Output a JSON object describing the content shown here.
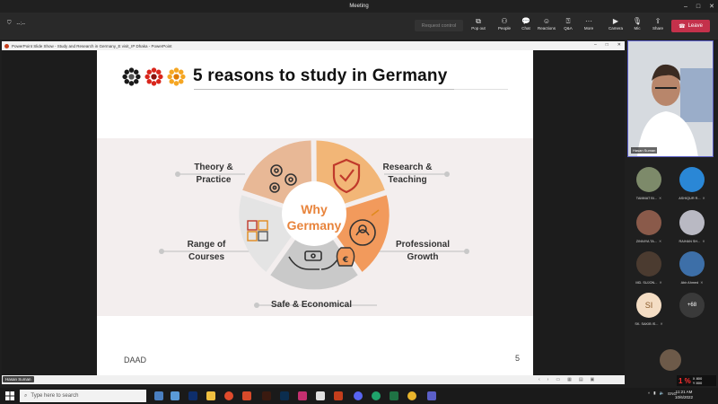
{
  "window": {
    "title": "Meeting",
    "controls": [
      "–",
      "□",
      "✕"
    ]
  },
  "toolbar": {
    "timer": "--:--",
    "request_control": "Request control",
    "buttons": [
      {
        "label": "Pop out",
        "icon": "popout-icon"
      },
      {
        "label": "People",
        "icon": "people-icon"
      },
      {
        "label": "Chat",
        "icon": "chat-icon"
      },
      {
        "label": "Reactions",
        "icon": "reactions-icon"
      },
      {
        "label": "Q&A",
        "icon": "qa-icon"
      },
      {
        "label": "More",
        "icon": "more-icon"
      },
      {
        "label": "Camera",
        "icon": "camera-icon"
      },
      {
        "label": "Mic",
        "icon": "mic-off-icon"
      },
      {
        "label": "Share",
        "icon": "share-icon"
      }
    ],
    "leave": "Leave"
  },
  "ppt": {
    "window_title": "PowerPoint Slide Show - Study and Research in Germany_E visit_IP Dhaka - PowerPoint",
    "slide": {
      "title": "5 reasons to study in Germany",
      "center_text_line1": "Why",
      "center_text_line2": "Germany",
      "labels": {
        "theory": [
          "Theory &",
          "Practice"
        ],
        "research": [
          "Research &",
          "Teaching"
        ],
        "professional": [
          "Professional",
          "Growth"
        ],
        "safe": [
          "Safe & Economical"
        ],
        "range": [
          "Range of",
          "Courses"
        ]
      },
      "footer_left": "DAAD",
      "page_number": "5"
    },
    "presenter_tag": "Hasan Suman"
  },
  "panel": {
    "main_video_name": "Hasan Suman",
    "participants": [
      {
        "name": "TAMMAT BI...",
        "initials": ""
      },
      {
        "name": "ASHIQUR R...",
        "initials": ""
      },
      {
        "name": "ZINNIYA TA...",
        "initials": ""
      },
      {
        "name": "RAIHAN SH...",
        "initials": ""
      },
      {
        "name": "MD. SUJON...",
        "initials": ""
      },
      {
        "name": "Abir Ahmed",
        "initials": ""
      },
      {
        "name": "SK. SAKIB IS...",
        "initials": "SI"
      },
      {
        "name": "",
        "initials": "+68"
      }
    ]
  },
  "overlay": {
    "big_number": "1 %",
    "x": "X 800",
    "y": "Y 800"
  },
  "taskbar": {
    "search_placeholder": "Type here to search",
    "time": "11:21 AM",
    "date": "10/6/2022",
    "lang": "ENG"
  },
  "colors": {
    "accent_orange": "#f29a5c",
    "tan": "#e8b896",
    "gray_segment": "#c9c9c9",
    "leave_red": "#c4314b",
    "teams_purple": "#5b5fc7"
  }
}
